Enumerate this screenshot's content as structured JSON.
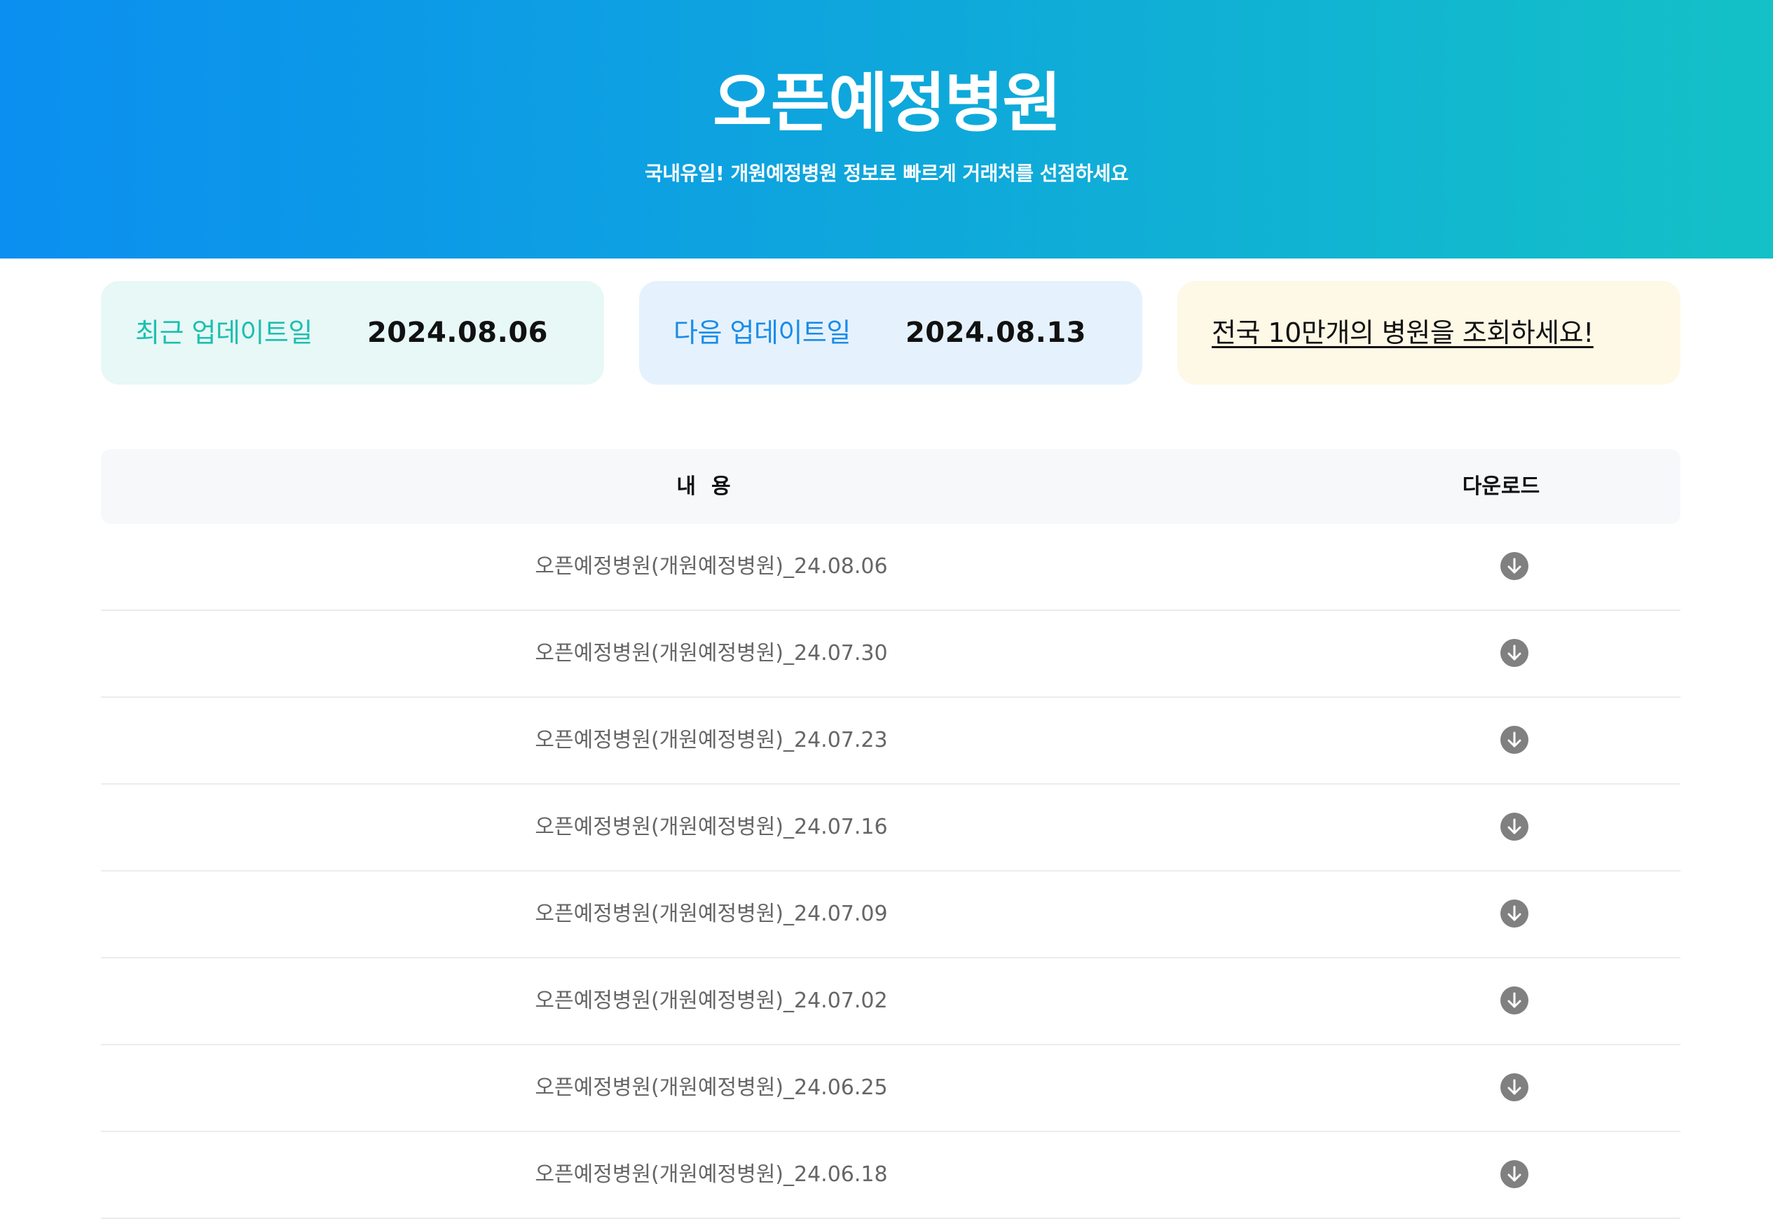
{
  "hero": {
    "title": "오픈예정병원",
    "subtitle": "국내유일! 개원예정병원 정보로 빠르게 거래처를 선점하세요"
  },
  "cards": {
    "recent": {
      "label": "최근 업데이트일",
      "date": "2024.08.06"
    },
    "next": {
      "label": "다음 업데이트일",
      "date": "2024.08.13"
    },
    "promo": {
      "link_text": "전국 10만개의 병원을 조회하세요!"
    }
  },
  "table": {
    "headers": {
      "content": "내용",
      "download": "다운로드"
    },
    "rows": [
      {
        "title": "오픈예정병원(개원예정병원)_24.08.06",
        "icon": "download-icon"
      },
      {
        "title": "오픈예정병원(개원예정병원)_24.07.30",
        "icon": "download-icon"
      },
      {
        "title": "오픈예정병원(개원예정병원)_24.07.23",
        "icon": "download-icon"
      },
      {
        "title": "오픈예정병원(개원예정병원)_24.07.16",
        "icon": "download-icon"
      },
      {
        "title": "오픈예정병원(개원예정병원)_24.07.09",
        "icon": "download-icon"
      },
      {
        "title": "오픈예정병원(개원예정병원)_24.07.02",
        "icon": "download-icon"
      },
      {
        "title": "오픈예정병원(개원예정병원)_24.06.25",
        "icon": "download-icon"
      },
      {
        "title": "오픈예정병원(개원예정병원)_24.06.18",
        "icon": "download-icon"
      }
    ]
  },
  "colors": {
    "hero_gradient_start": "#0b8ff0",
    "hero_gradient_end": "#14c1c7",
    "recent_accent": "#1cbfb0",
    "next_accent": "#1a8ce8",
    "download_icon": "#808080"
  }
}
